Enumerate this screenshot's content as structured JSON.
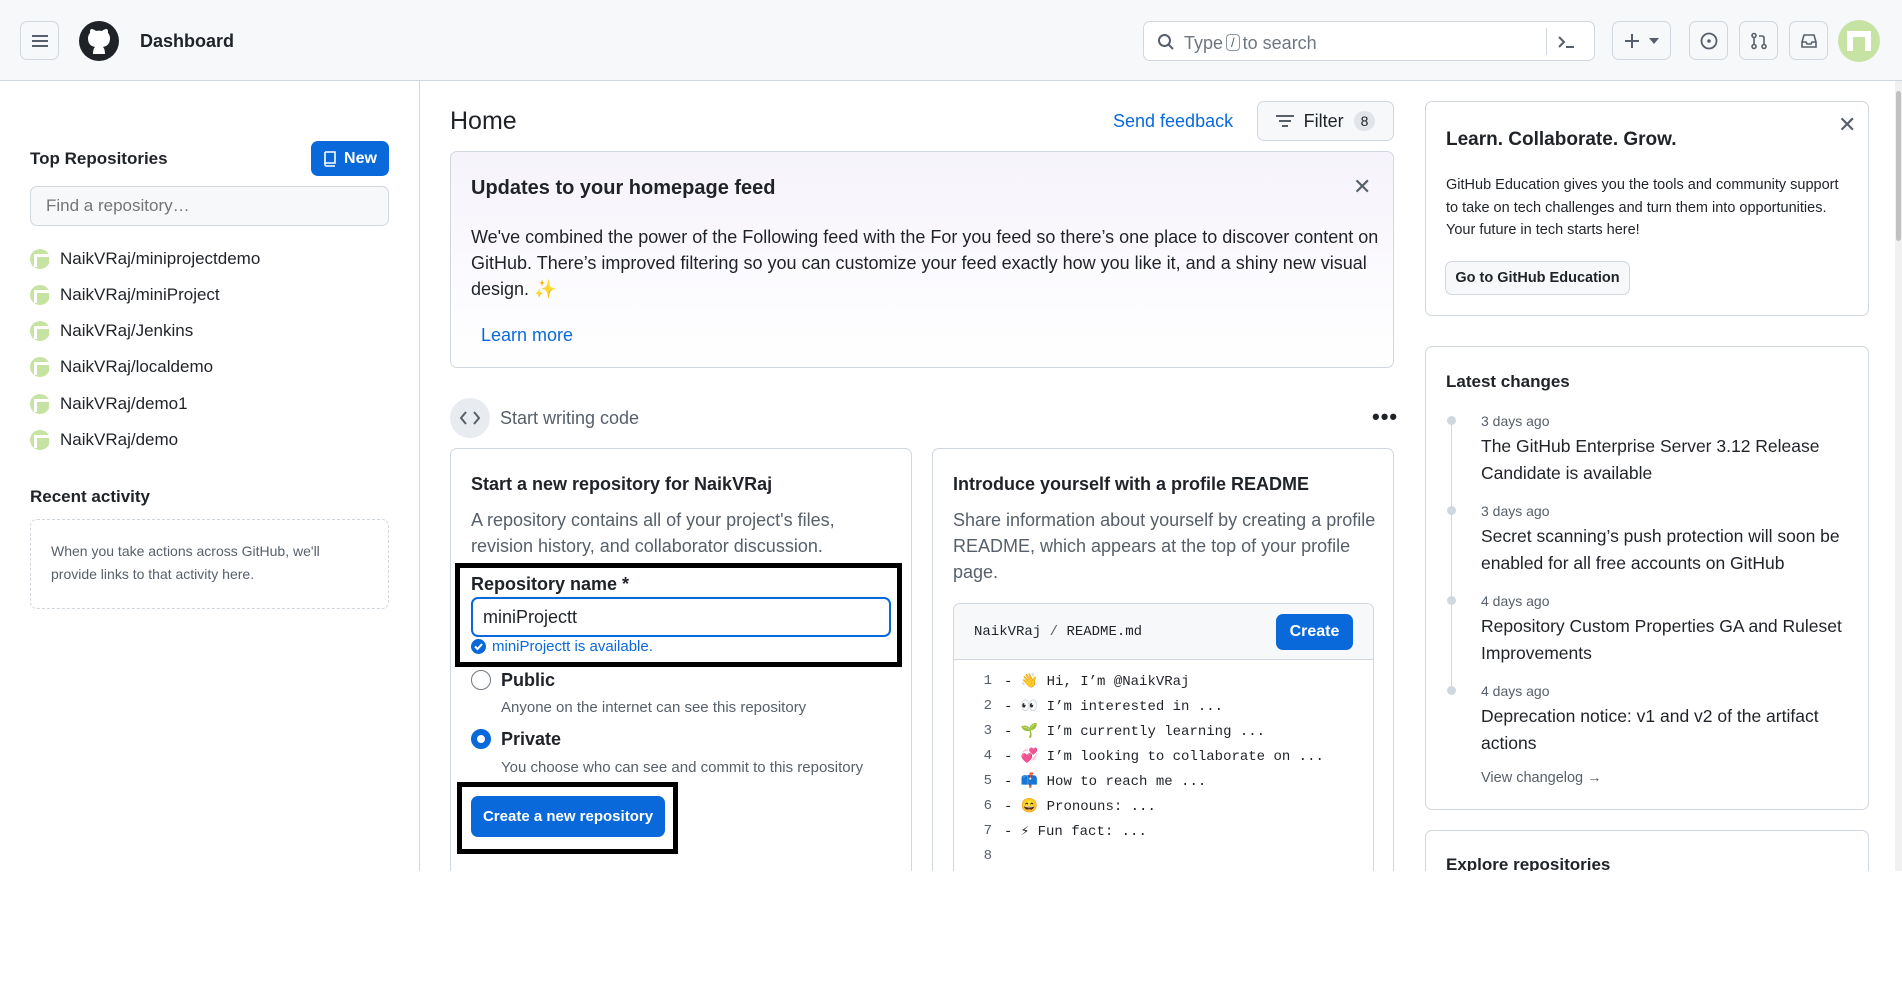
{
  "header": {
    "title": "Dashboard",
    "search_prefix": "Type",
    "search_key": "/",
    "search_suffix": "to search",
    "icons": [
      "menu-icon",
      "github-logo-icon",
      "search-icon",
      "command-palette-icon",
      "plus-icon",
      "issues-icon",
      "pull-requests-icon",
      "inbox-icon"
    ]
  },
  "sidebar": {
    "top_repos_title": "Top Repositories",
    "new_button": "New",
    "find_placeholder": "Find a repository…",
    "repos": [
      "NaikVRaj/miniprojectdemo",
      "NaikVRaj/miniProject",
      "NaikVRaj/Jenkins",
      "NaikVRaj/localdemo",
      "NaikVRaj/demo1",
      "NaikVRaj/demo"
    ],
    "recent_title": "Recent activity",
    "recent_text": "When you take actions across GitHub, we'll provide links to that activity here."
  },
  "main": {
    "home_title": "Home",
    "send_feedback": "Send feedback",
    "filter_label": "Filter",
    "filter_count": "8",
    "updates": {
      "title": "Updates to your homepage feed",
      "body": "We've combined the power of the Following feed with the For you feed so there’s one place to discover content on GitHub. There’s improved filtering so you can customize your feed exactly how you like it, and a shiny new visual design. ✨",
      "learn_more": "Learn more"
    },
    "start_writing": "Start writing code",
    "new_repo": {
      "title": "Start a new repository for NaikVRaj",
      "desc": "A repository contains all of your project's files, revision history, and collaborator discussion.",
      "name_label": "Repository name *",
      "name_value": "miniProjectt",
      "available_msg": "miniProjectt is available.",
      "public_label": "Public",
      "public_desc": "Anyone on the internet can see this repository",
      "private_label": "Private",
      "private_desc": "You choose who can see and commit to this repository",
      "visibility_selected": "Private",
      "create_button": "Create a new repository"
    },
    "readme": {
      "title": "Introduce yourself with a profile README",
      "desc": "Share information about yourself by creating a profile README, which appears at the top of your profile page.",
      "path_user": "NaikVRaj",
      "path_sep": "/",
      "path_file": "README.md",
      "create_button": "Create",
      "lines": [
        {
          "n": "1",
          "text": "- 👋 Hi, I’m @NaikVRaj"
        },
        {
          "n": "2",
          "text": "- 👀 I’m interested in ..."
        },
        {
          "n": "3",
          "text": "- 🌱 I’m currently learning ..."
        },
        {
          "n": "4",
          "text": "- 💞️ I’m looking to collaborate on ..."
        },
        {
          "n": "5",
          "text": "- 📫 How to reach me ..."
        },
        {
          "n": "6",
          "text": "- 😄 Pronouns: ..."
        },
        {
          "n": "7",
          "text": "- ⚡ Fun fact: ..."
        },
        {
          "n": "8",
          "text": ""
        }
      ]
    }
  },
  "right": {
    "edu": {
      "title": "Learn. Collaborate. Grow.",
      "body": "GitHub Education gives you the tools and community support to take on tech challenges and turn them into opportunities. Your future in tech starts here!",
      "button": "Go to GitHub Education"
    },
    "changes": {
      "title": "Latest changes",
      "items": [
        {
          "time": "3 days ago",
          "text": "The GitHub Enterprise Server 3.12 Release Candidate is available"
        },
        {
          "time": "3 days ago",
          "text": "Secret scanning’s push protection will soon be enabled for all free accounts on GitHub"
        },
        {
          "time": "4 days ago",
          "text": "Repository Custom Properties GA and Ruleset Improvements"
        },
        {
          "time": "4 days ago",
          "text": "Deprecation notice: v1 and v2 of the artifact actions"
        }
      ],
      "view_changelog": "View changelog →"
    },
    "explore_title": "Explore repositories"
  },
  "colors": {
    "accent": "#0969da",
    "border": "#d0d7de",
    "success": "#1a7f37",
    "highlight_box": "#000000"
  }
}
